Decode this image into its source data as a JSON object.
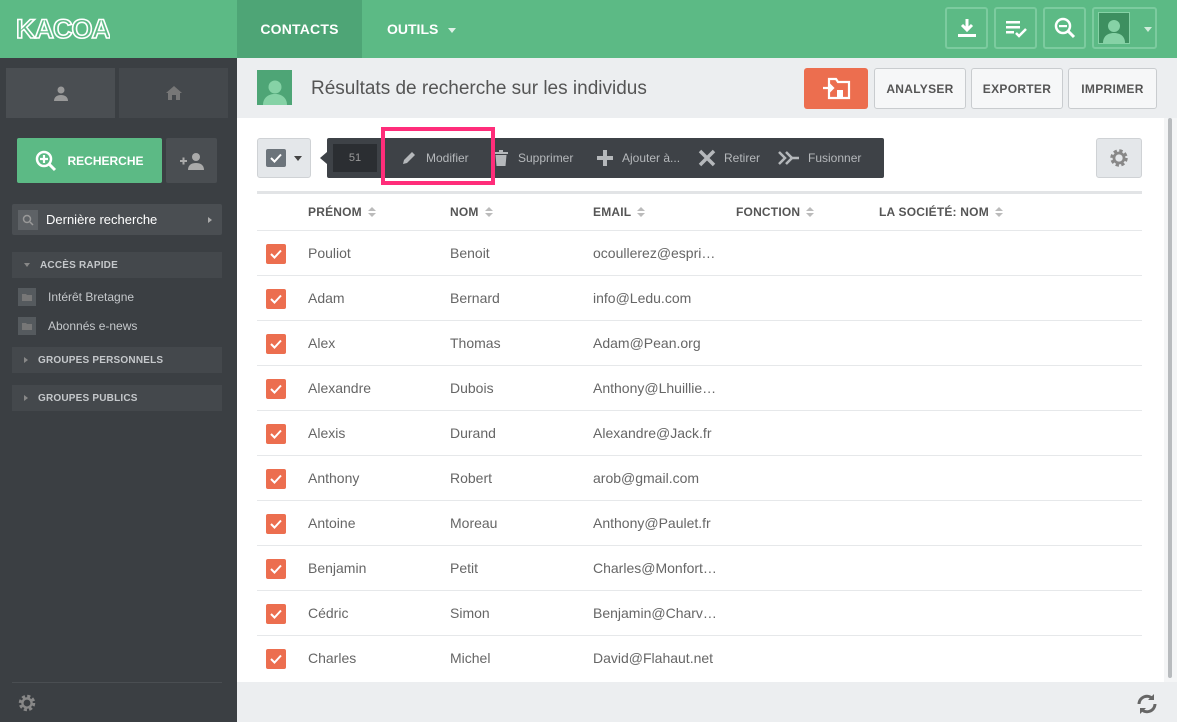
{
  "brand": {
    "logo_text": "KACOA"
  },
  "topnav": {
    "contacts": "CONTACTS",
    "outils": "OUTILS",
    "icons": [
      "download-icon",
      "checklist-icon",
      "search-zoom-icon"
    ]
  },
  "sidebar": {
    "tabs": [
      "person-icon",
      "home-icon"
    ],
    "recherche_label": "RECHERCHE",
    "derniere_recherche": "Dernière recherche",
    "sections": {
      "acces_rapide": "ACCÈS RAPIDE",
      "groupes_personnels": "GROUPES PERSONNELS",
      "groupes_publics": "GROUPES PUBLICS"
    },
    "quick_items": [
      "Intérêt Bretagne",
      "Abonnés e-news"
    ]
  },
  "header": {
    "title": "Résultats de recherche sur les individus",
    "analyser": "ANALYSER",
    "exporter": "EXPORTER",
    "imprimer": "IMPRIMER"
  },
  "actions": {
    "count": "51",
    "modifier": "Modifier",
    "supprimer": "Supprimer",
    "ajouter": "Ajouter à...",
    "retirer": "Retirer",
    "fusionner": "Fusionner"
  },
  "table": {
    "columns": [
      "PRÉNOM",
      "NOM",
      "EMAIL",
      "FONCTION",
      "LA SOCIÉTÉ: NOM"
    ],
    "rows": [
      {
        "prenom": "Pouliot",
        "nom": "Benoit",
        "email": "ocoullerez@esprit.org",
        "checked": true
      },
      {
        "prenom": "Adam",
        "nom": "Bernard",
        "email": "info@Ledu.com",
        "checked": true
      },
      {
        "prenom": "Alex",
        "nom": "Thomas",
        "email": "Adam@Pean.org",
        "checked": true
      },
      {
        "prenom": "Alexandre",
        "nom": "Dubois",
        "email": "Anthony@Lhuillier.fr",
        "checked": true
      },
      {
        "prenom": "Alexis",
        "nom": "Durand",
        "email": "Alexandre@Jack.fr",
        "checked": true
      },
      {
        "prenom": "Anthony",
        "nom": "Robert",
        "email": "arob@gmail.com",
        "checked": true
      },
      {
        "prenom": "Antoine",
        "nom": "Moreau",
        "email": "Anthony@Paulet.fr",
        "checked": true
      },
      {
        "prenom": "Benjamin",
        "nom": "Petit",
        "email": "Charles@Monfort.com",
        "checked": true
      },
      {
        "prenom": "Cédric",
        "nom": "Simon",
        "email": "Benjamin@Charvet.fr",
        "checked": true
      },
      {
        "prenom": "Charles",
        "nom": "Michel",
        "email": "David@Flahaut.net",
        "checked": true
      }
    ]
  },
  "colors": {
    "brand_green": "#5cba85",
    "accent_orange": "#ec6e4f",
    "highlight_pink": "#ff2d7a",
    "sidebar_bg": "#3b3f43"
  }
}
